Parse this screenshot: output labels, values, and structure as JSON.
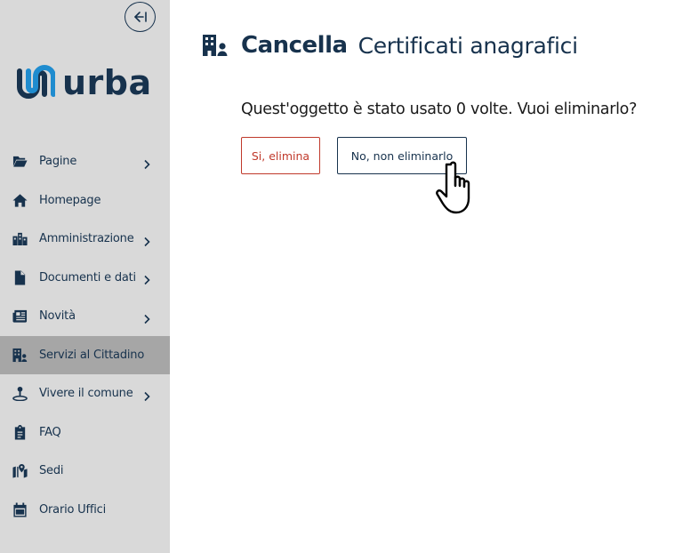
{
  "sidebar": {
    "logo_text": "urba",
    "items": [
      {
        "label": "Pagine",
        "icon": "folder-open-icon",
        "chevron": true,
        "active": false
      },
      {
        "label": "Homepage",
        "icon": "home-icon",
        "chevron": false,
        "active": false
      },
      {
        "label": "Amministrazione",
        "icon": "city-icon",
        "chevron": true,
        "active": false
      },
      {
        "label": "Documenti e dati",
        "icon": "file-icon",
        "chevron": true,
        "active": false
      },
      {
        "label": "Novità",
        "icon": "newspaper-icon",
        "chevron": true,
        "active": false
      },
      {
        "label": "Servizi al Cittadino",
        "icon": "building-user-icon",
        "chevron": false,
        "active": true
      },
      {
        "label": "Vivere il comune",
        "icon": "map-pin-icon",
        "chevron": true,
        "active": false
      },
      {
        "label": "FAQ",
        "icon": "clipboard-icon",
        "chevron": false,
        "active": false
      },
      {
        "label": "Sedi",
        "icon": "map-location-icon",
        "chevron": false,
        "active": false
      },
      {
        "label": "Orario Uffici",
        "icon": "calendar-icon",
        "chevron": false,
        "active": false
      }
    ]
  },
  "header": {
    "action": "Cancella",
    "entity": "Certificati anagrafici",
    "icon": "building-user-icon"
  },
  "dialog": {
    "question": "Quest'oggetto è stato usato 0 volte. Vuoi eliminarlo?",
    "confirm_label": "Si, elimina",
    "cancel_label": "No, non eliminarlo"
  },
  "colors": {
    "primary": "#17324d",
    "danger": "#c0392b",
    "sidebar_bg": "#d9d9d9",
    "sidebar_active_bg": "#a6a6a6",
    "logo_accent": "#1f8ccf"
  }
}
